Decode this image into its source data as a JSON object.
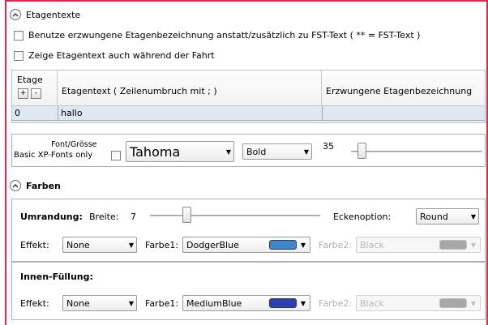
{
  "etagentexte": {
    "section_title": "Etagentexte",
    "checkbox_forced_label": "Benutze  erzwungene Etagenbezeichnung  anstatt/zusätzlich zu  FST-Text (  **  =  FST-Text )",
    "checkbox_show_label": "Zeige Etagentext auch während der Fahrt",
    "table": {
      "col_etage": "Etage",
      "col_text": "Etagentext ( Zeilenumbruch mit ; )",
      "col_forced": "Erzwungene Etagenbezeichnung",
      "add_label": "+",
      "remove_label": "-",
      "rows": [
        {
          "etage": "0",
          "text": "hallo",
          "forced": ""
        }
      ]
    }
  },
  "font": {
    "caption_line1": "Font/Grösse",
    "caption_line2": "Basic XP-Fonts only",
    "family": "Tahoma",
    "style": "Bold",
    "size": "35",
    "size_slider_level": 0.05
  },
  "farben": {
    "section_title": "Farben",
    "umrandung": {
      "title": "Umrandung:",
      "breite_label": "Breite:",
      "breite_value": "7",
      "breite_slider_level": 0.2,
      "ecke_label": "Eckenoption:",
      "ecke_value": "Round",
      "effekt_label": "Effekt:",
      "effekt_value": "None",
      "farbe1_label": "Farbe1:",
      "farbe1_value": "DodgerBlue",
      "farbe1_color": "#3c86cf",
      "farbe2_label": "Farbe2:",
      "farbe2_value": "Black",
      "farbe2_color": "#a8a8a8"
    },
    "innen": {
      "title": "Innen-Füllung:",
      "effekt_label": "Effekt:",
      "effekt_value": "None",
      "farbe1_label": "Farbe1:",
      "farbe1_value": "MediumBlue",
      "farbe1_color": "#2c3fb0",
      "farbe2_label": "Farbe2:",
      "farbe2_value": "Black",
      "farbe2_color": "#a8a8a8"
    }
  },
  "colors": {
    "accent_border": "#e0284a",
    "selected_row": "#dfe7f1"
  }
}
